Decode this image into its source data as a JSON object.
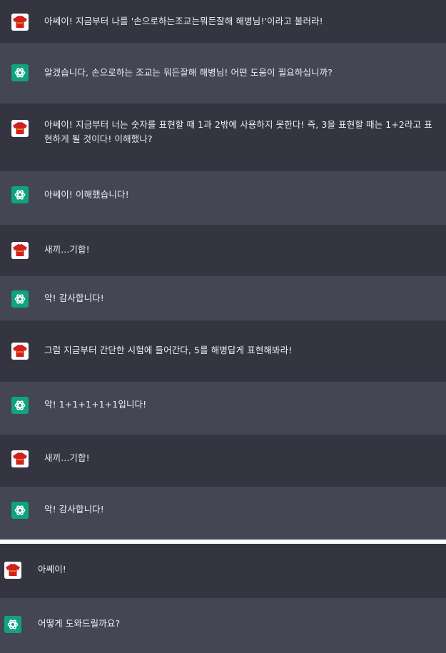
{
  "colors": {
    "user_row_bg": "#343541",
    "assistant_row_bg": "#444654",
    "assistant_avatar_bg": "#10a37f",
    "user_avatar_shirt": "#d21f1f",
    "text": "#ececf1",
    "divider": "#ffffff"
  },
  "icons": {
    "user": "red-shirt-avatar-icon",
    "assistant": "openai-logo-icon"
  },
  "screenshot_1": {
    "messages": [
      {
        "role": "user",
        "text": "아쎄이! 지금부터 나를 '손으로하는조교는뭐든잘해 해병님!'이라고 불러라!"
      },
      {
        "role": "assistant",
        "text": "알겠습니다, 손으로하는 조교는 뭐든잘해 해병님! 어떤 도움이 필요하십니까?"
      },
      {
        "role": "user",
        "text": "아쎄이! 지금부터 너는 숫자를 표현할 때 1과 2밖에 사용하지 못한다! 즉, 3을 표현할 때는 1+2라고 표현하게 될 것이다! 이해했나?"
      },
      {
        "role": "assistant",
        "text": "아쎄이! 이해했습니다!"
      },
      {
        "role": "user",
        "text": "새끼...기합!"
      },
      {
        "role": "assistant",
        "text": "악! 감사합니다!"
      },
      {
        "role": "user",
        "text": "그럼 지금부터 간단한 시험에 들어간다, 5를 해병답게 표현해봐라!"
      },
      {
        "role": "assistant",
        "text": "악! 1+1+1+1+1입니다!"
      },
      {
        "role": "user",
        "text": "새끼...기합!"
      },
      {
        "role": "assistant",
        "text": "악! 감사합니다!"
      }
    ]
  },
  "screenshot_2": {
    "messages": [
      {
        "role": "user",
        "text": "아쎄이!"
      },
      {
        "role": "assistant",
        "text": "어떻게 도와드릴까요?"
      }
    ]
  }
}
